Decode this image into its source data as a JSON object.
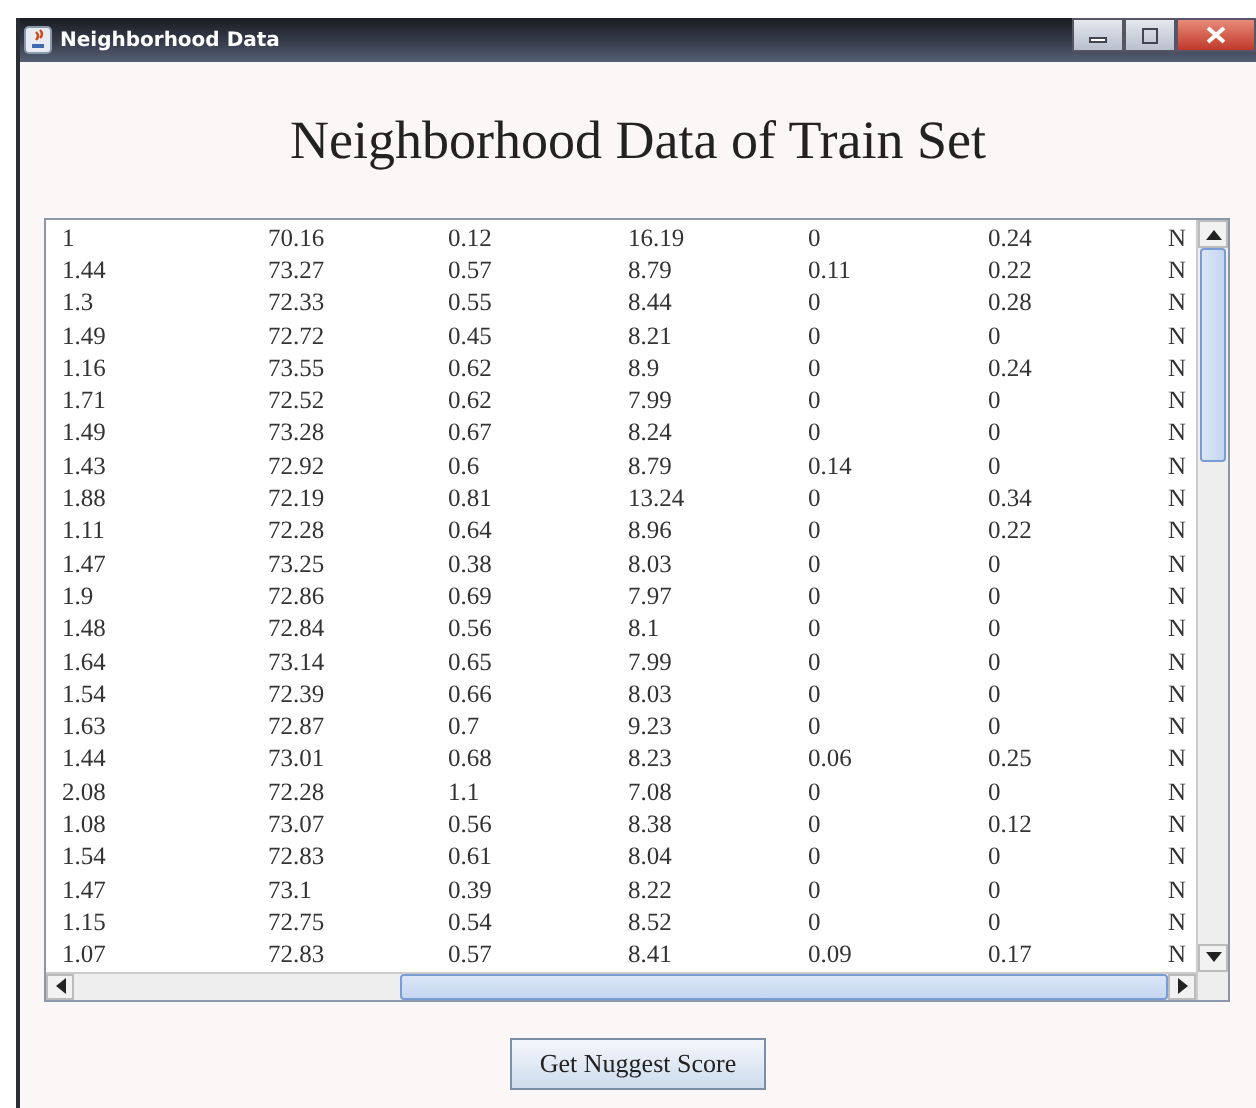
{
  "window": {
    "title": "Neighborhood Data"
  },
  "heading": "Neighborhood Data of Train Set",
  "table": {
    "rows": [
      [
        "1",
        "70.16",
        "0.12",
        "16.19",
        "0",
        "0.24",
        "N"
      ],
      [
        "1.44",
        "73.27",
        "0.57",
        "8.79",
        "0.11",
        "0.22",
        "N"
      ],
      [
        "1.3",
        "72.33",
        "0.55",
        "8.44",
        "0",
        "0.28",
        "N"
      ],
      [
        "1.49",
        "72.72",
        "0.45",
        "8.21",
        "0",
        "0",
        "N"
      ],
      [
        "1.16",
        "73.55",
        "0.62",
        "8.9",
        "0",
        "0.24",
        "N"
      ],
      [
        "1.71",
        "72.52",
        "0.62",
        "7.99",
        "0",
        "0",
        "N"
      ],
      [
        "1.49",
        "73.28",
        "0.67",
        "8.24",
        "0",
        "0",
        "N"
      ],
      [
        "1.43",
        "72.92",
        "0.6",
        "8.79",
        "0.14",
        "0",
        "N"
      ],
      [
        "1.88",
        "72.19",
        "0.81",
        "13.24",
        "0",
        "0.34",
        "N"
      ],
      [
        "1.11",
        "72.28",
        "0.64",
        "8.96",
        "0",
        "0.22",
        "N"
      ],
      [
        "1.47",
        "73.25",
        "0.38",
        "8.03",
        "0",
        "0",
        "N"
      ],
      [
        "1.9",
        "72.86",
        "0.69",
        "7.97",
        "0",
        "0",
        "N"
      ],
      [
        "1.48",
        "72.84",
        "0.56",
        "8.1",
        "0",
        "0",
        "N"
      ],
      [
        "1.64",
        "73.14",
        "0.65",
        "7.99",
        "0",
        "0",
        "N"
      ],
      [
        "1.54",
        "72.39",
        "0.66",
        "8.03",
        "0",
        "0",
        "N"
      ],
      [
        "1.63",
        "72.87",
        "0.7",
        "9.23",
        "0",
        "0",
        "N"
      ],
      [
        "1.44",
        "73.01",
        "0.68",
        "8.23",
        "0.06",
        "0.25",
        "N"
      ],
      [
        "2.08",
        "72.28",
        "1.1",
        "7.08",
        "0",
        "0",
        "N"
      ],
      [
        "1.08",
        "73.07",
        "0.56",
        "8.38",
        "0",
        "0.12",
        "N"
      ],
      [
        "1.54",
        "72.83",
        "0.61",
        "8.04",
        "0",
        "0",
        "N"
      ],
      [
        "1.47",
        "73.1",
        "0.39",
        "8.22",
        "0",
        "0",
        "N"
      ],
      [
        "1.15",
        "72.75",
        "0.54",
        "8.52",
        "0",
        "0",
        "N"
      ],
      [
        "1.07",
        "72.83",
        "0.57",
        "8.41",
        "0.09",
        "0.17",
        "N"
      ]
    ]
  },
  "buttons": [
    "Get Nuggest Score"
  ]
}
